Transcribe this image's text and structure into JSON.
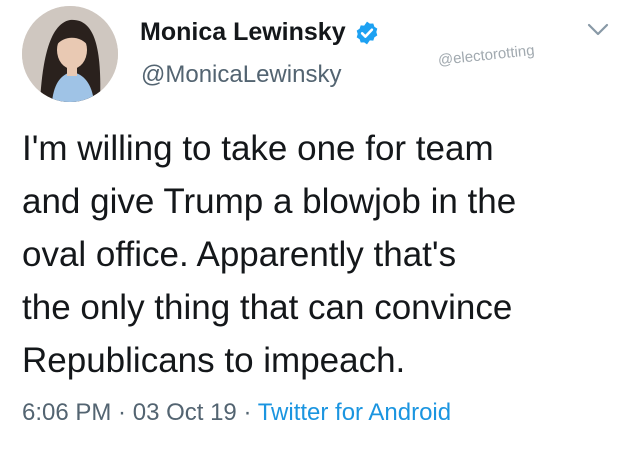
{
  "author": {
    "display_name": "Monica Lewinsky",
    "handle": "@MonicaLewinsky",
    "verified": true,
    "avatar_icon": "profile-photo"
  },
  "watermark": "@electorotting",
  "menu_icon": "chevron-down-icon",
  "tweet": {
    "lines": [
      "I'm willing to take one for team",
      "and give Trump a blowjob in the",
      "oval office. Apparently that's",
      "the only thing that can convince",
      "Republicans to impeach."
    ]
  },
  "meta": {
    "time": "6:06 PM",
    "separator": " · ",
    "date": "03 Oct 19",
    "source": "Twitter for Android"
  },
  "colors": {
    "text": "#14171a",
    "secondary": "#536471",
    "link": "#1b95e0",
    "verified_badge": "#1da1f2"
  }
}
